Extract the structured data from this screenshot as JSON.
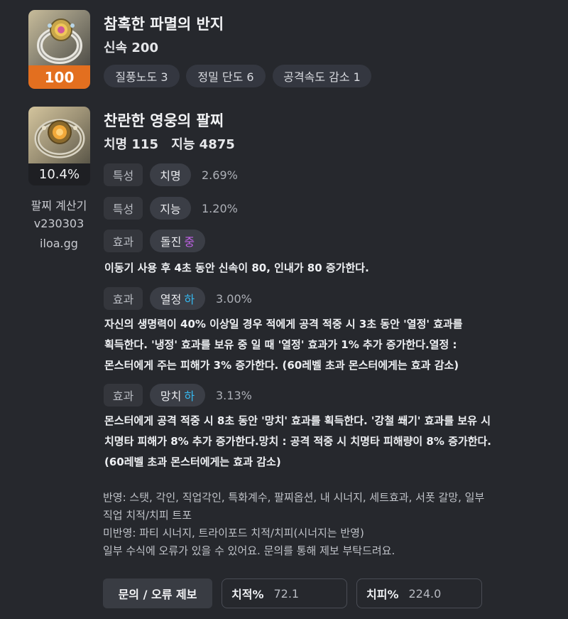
{
  "ring": {
    "name": "참혹한 파멸의 반지",
    "stat_label": "신속",
    "stat_value": "200",
    "quality": "100",
    "engravings": [
      "질풍노도 3",
      "정밀 단도 6",
      "공격속도 감소 1"
    ],
    "colors": {
      "quality_bg": "#e36f1f"
    }
  },
  "bracelet": {
    "name": "찬란한 영웅의 팔찌",
    "stats": [
      {
        "label": "치명",
        "value": "115"
      },
      {
        "label": "지능",
        "value": "4875"
      }
    ],
    "percent": "10.4%",
    "calculator": {
      "title": "팔찌 계산기",
      "version": "v230303",
      "site": "iloa.gg"
    },
    "options": [
      {
        "type": "특성",
        "name": "치명",
        "grade": "",
        "value": "2.69%"
      },
      {
        "type": "특성",
        "name": "지능",
        "grade": "",
        "value": "1.20%"
      },
      {
        "type": "효과",
        "name": "돌진",
        "grade": "중",
        "value": "",
        "desc": [
          "이동기 사용 후 4초 동안 신속이 80, 인내가 80 증가한다."
        ]
      },
      {
        "type": "효과",
        "name": "열정",
        "grade": "하",
        "value": "3.00%",
        "desc": [
          "자신의 생명력이 40% 이상일 경우 적에게 공격 적중 시 3초 동안 '열정' 효과를",
          "획득한다. '냉정' 효과를 보유 중 일 때 '열정' 효과가 1% 추가 증가한다.열정 :",
          "몬스터에게 주는 피해가 3% 증가한다. (60레벨 초과 몬스터에게는 효과 감소)"
        ]
      },
      {
        "type": "효과",
        "name": "망치",
        "grade": "하",
        "value": "3.13%",
        "desc": [
          "몬스터에게 공격 적중 시 8초 동안 '망치' 효과를 획득한다. '강철 쐐기' 효과를 보유 시",
          "치명타 피해가 8% 추가 증가한다.망치 : 공격 적중 시 치명타 피해량이 8% 증가한다.",
          "(60레벨 초과 몬스터에게는 효과 감소)"
        ]
      }
    ],
    "grade_colors": {
      "중": "#c062e8",
      "하": "#35b7ee"
    }
  },
  "notes": [
    "반영: 스탯, 각인, 직업각인, 특화계수, 팔찌옵션, 내 시너지, 세트효과, 서폿 갈망, 일부",
    "직업 치적/치피 트포",
    "미반영: 파티 시너지, 트라이포드 치적/치피(시너지는 반영)",
    "일부 수식에 오류가 있을 수 있어요. 문의를 통해 제보 부탁드려요."
  ],
  "footer": {
    "report_button": "문의 / 오류 제보",
    "crit_rate": {
      "label": "치적%",
      "value": "72.1"
    },
    "crit_damage": {
      "label": "치피%",
      "value": "224.0"
    }
  }
}
